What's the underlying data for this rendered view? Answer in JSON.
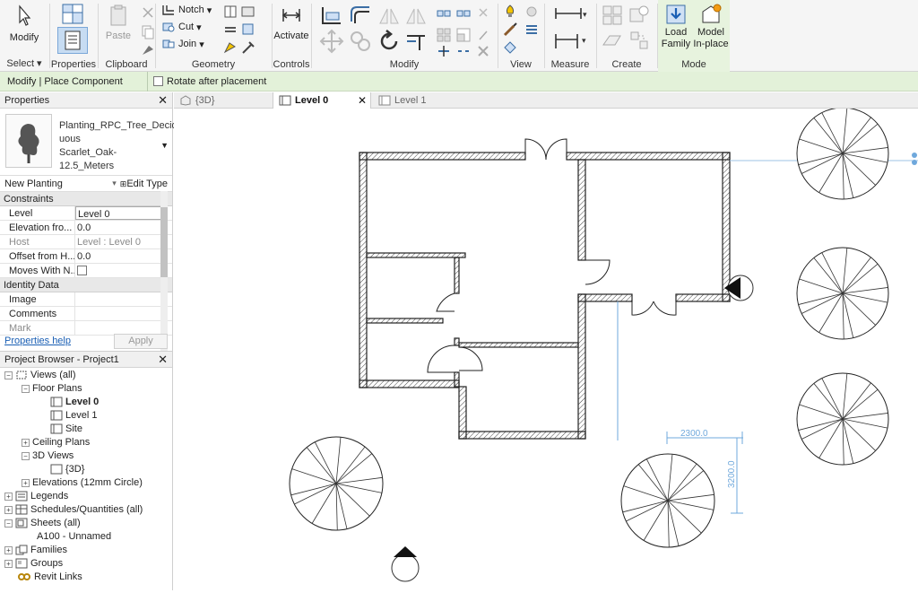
{
  "ribbon": {
    "select": {
      "modify": "Modify",
      "label": "Select ▾"
    },
    "properties": {
      "label": "Properties"
    },
    "clipboard": {
      "paste": "Paste",
      "label": "Clipboard"
    },
    "geometry": {
      "notch": "Notch",
      "cut": "Cut",
      "join": "Join",
      "label": "Geometry"
    },
    "controls": {
      "activate": "Activate",
      "label": "Controls"
    },
    "modify": {
      "label": "Modify"
    },
    "view": {
      "label": "View"
    },
    "measure": {
      "label": "Measure"
    },
    "create": {
      "label": "Create"
    },
    "mode": {
      "load_family": "Load\nFamily",
      "load1": "Load",
      "load2": "Family",
      "model1": "Model",
      "model2": "In-place",
      "label": "Mode"
    }
  },
  "context_bar": {
    "name": "Modify | Place Component",
    "rotate_label": "Rotate after placement"
  },
  "properties": {
    "title": "Properties",
    "type_name": "Planting_RPC_Tree_Deciduous Scarlet_Oak-12.5_Meters",
    "type_line1": "Planting_RPC_Tree_Decid",
    "type_line2": "uous",
    "type_line3": "Scarlet_Oak-12.5_Meters",
    "instance": "New Planting",
    "edit_type": "Edit Type",
    "categories": {
      "constraints": "Constraints",
      "identity": "Identity Data"
    },
    "rows": [
      {
        "key": "Level",
        "value": "Level 0"
      },
      {
        "key": "Elevation fro...",
        "value": "0.0"
      },
      {
        "key": "Host",
        "value": "Level : Level 0"
      },
      {
        "key": "Offset from H...",
        "value": "0.0"
      },
      {
        "key": "Moves With N...",
        "value": ""
      },
      {
        "key": "Image",
        "value": ""
      },
      {
        "key": "Comments",
        "value": ""
      },
      {
        "key": "Mark",
        "value": ""
      }
    ],
    "help": "Properties help",
    "apply": "Apply"
  },
  "browser": {
    "title": "Project Browser - Project1",
    "items": [
      {
        "label": "Views (all)"
      },
      {
        "label": "Floor Plans"
      },
      {
        "label": "Level 0"
      },
      {
        "label": "Level 1"
      },
      {
        "label": "Site"
      },
      {
        "label": "Ceiling Plans"
      },
      {
        "label": "3D Views"
      },
      {
        "label": "{3D}"
      },
      {
        "label": "Elevations (12mm Circle)"
      },
      {
        "label": "Legends"
      },
      {
        "label": "Schedules/Quantities (all)"
      },
      {
        "label": "Sheets (all)"
      },
      {
        "label": "A100 - Unnamed"
      },
      {
        "label": "Families"
      },
      {
        "label": "Groups"
      },
      {
        "label": "Revit Links"
      }
    ]
  },
  "tabs": [
    {
      "label": "{3D}"
    },
    {
      "label": "Level 0"
    },
    {
      "label": "Level 1"
    }
  ],
  "canvas": {
    "dim_horizontal": "2300.0",
    "dim_vertical": "3200.0"
  },
  "colors": {
    "accent": "#1a5fb4",
    "context": "#e3f1d9",
    "dimension": "#6fa8dc"
  }
}
